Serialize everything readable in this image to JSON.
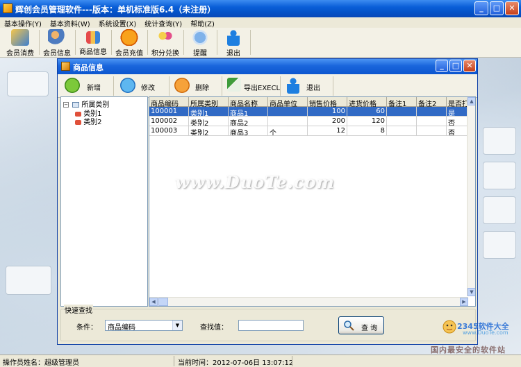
{
  "window": {
    "title": "辉创会员管理软件---版本：单机标准版6.4（未注册）"
  },
  "menu": [
    "基本操作(Y)",
    "基本资料(W)",
    "系统设置(X)",
    "统计查询(Y)",
    "帮助(Z)"
  ],
  "main_toolbar": [
    {
      "label": "会员消费",
      "icon": "card-payment-icon"
    },
    {
      "label": "会员信息",
      "icon": "members-icon"
    },
    {
      "label": "商品信息",
      "icon": "products-icon"
    },
    {
      "label": "会员充值",
      "icon": "recharge-coin-icon"
    },
    {
      "label": "积分兑换",
      "icon": "points-exchange-icon"
    },
    {
      "label": "提醒",
      "icon": "reminder-icon"
    },
    {
      "label": "退出",
      "icon": "exit-person-icon"
    }
  ],
  "child_window": {
    "title": "商品信息",
    "toolbar": [
      {
        "label": "新增",
        "icon": "add-icon"
      },
      {
        "label": "修改",
        "icon": "edit-check-icon"
      },
      {
        "label": "删除",
        "icon": "delete-icon"
      },
      {
        "label": "导出EXECL",
        "icon": "export-arrow-icon"
      },
      {
        "label": "退出",
        "icon": "exit-person-icon"
      }
    ],
    "tree": {
      "root": "所属类别",
      "children": [
        "类别1",
        "类别2"
      ]
    },
    "grid": {
      "columns": [
        "商品编码",
        "所属类别",
        "商品名称",
        "商品单位",
        "销售价格",
        "进货价格",
        "备注1",
        "备注2",
        "是否打"
      ],
      "rows": [
        [
          "100001",
          "类别1",
          "商品1",
          "",
          "100",
          "60",
          "",
          "",
          "是"
        ],
        [
          "100002",
          "类别2",
          "商品2",
          "",
          "200",
          "120",
          "",
          "",
          "否"
        ],
        [
          "100003",
          "类别2",
          "商品3",
          "个",
          "12",
          "8",
          "",
          "",
          "否"
        ]
      ],
      "selected_row": 0
    },
    "quick_search": {
      "legend": "快速查找",
      "condition_label": "条件：",
      "condition_value": "商品编码",
      "value_label": "查找值：",
      "value": "",
      "search_button": "查 询"
    }
  },
  "status": {
    "operator": "操作员姓名：超级管理员",
    "time": "当前时间：2012-07-06日 13:07:12"
  },
  "watermark": "www.DuoTe.com",
  "corner_logo": {
    "brand": "2345软件大全",
    "url": "www.DuoTe.com",
    "slogan": "国内最安全的软件站"
  },
  "colors": {
    "title_bar": "#0a5fd8",
    "selection": "#316ac5"
  }
}
